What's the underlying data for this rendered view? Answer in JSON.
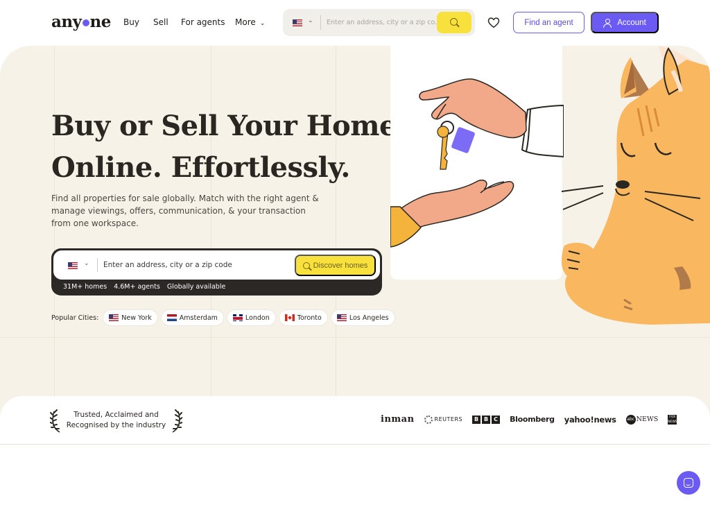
{
  "brand": {
    "name_part1": "any",
    "name_part2": "ne"
  },
  "nav": {
    "links": [
      "Buy",
      "Sell",
      "For agents",
      "More"
    ],
    "search_placeholder": "Enter an address, city or a zip co...",
    "find_agent_label": "Find an agent",
    "account_label": "Account"
  },
  "hero": {
    "title_line1": "Buy or Sell Your Home",
    "title_line2": "Online. Effortlessly.",
    "subtitle": "Find all properties for sale globally. Match with the right agent & manage viewings, offers, communication, & your transaction from one workspace.",
    "search_placeholder": "Enter an address, city or a zip code",
    "discover_label": "Discover homes",
    "stats": [
      "31M+ homes",
      "4.6M+ agents",
      "Globally available"
    ],
    "popular_label": "Popular Cities:",
    "cities": [
      "New York",
      "Amsterdam",
      "London",
      "Toronto",
      "Los Angeles"
    ]
  },
  "press": {
    "trusted_line1": "Trusted, Acclaimed and",
    "trusted_line2": "Recognised by the industry",
    "logos": [
      "inman",
      "REUTERS",
      "BBC",
      "Bloomberg",
      "yahoo!news",
      "abc NEWS",
      "fox news"
    ]
  },
  "colors": {
    "accent": "#6b5bf2",
    "yellow": "#f8e13c",
    "hero_bg": "#f6f2e7",
    "dark": "#2b2825"
  },
  "icons": [
    "us-flag-icon",
    "chevron-down-icon",
    "search-icon",
    "heart-icon",
    "user-icon",
    "laurel-icon",
    "chat-icon"
  ]
}
